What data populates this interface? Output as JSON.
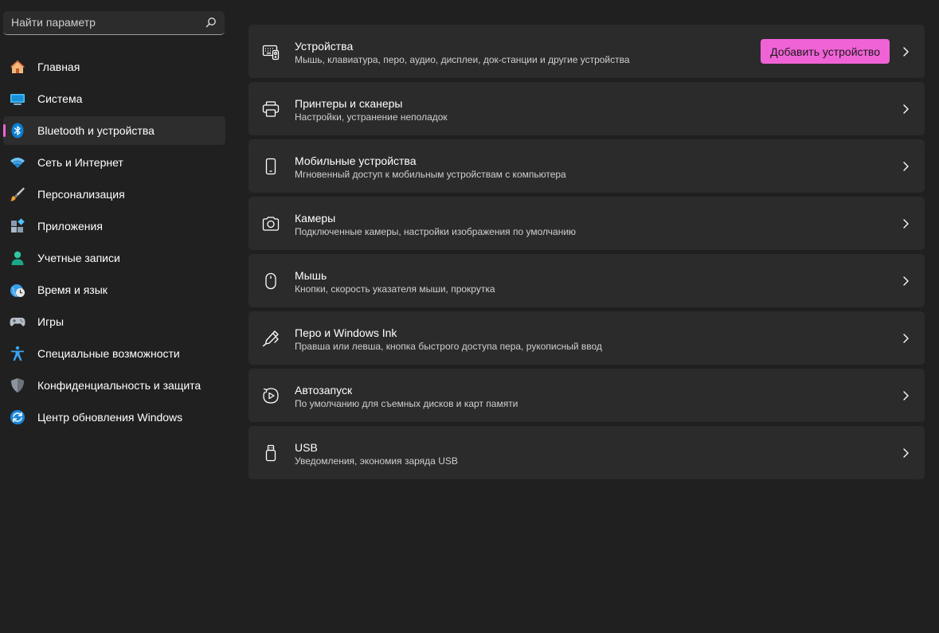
{
  "search": {
    "placeholder": "Найти параметр"
  },
  "accent_color": "#f063d6",
  "sidebar": {
    "items": [
      {
        "label": "Главная",
        "icon": "home-icon"
      },
      {
        "label": "Система",
        "icon": "monitor-icon"
      },
      {
        "label": "Bluetooth и устройства",
        "icon": "bluetooth-icon",
        "active": true
      },
      {
        "label": "Сеть и Интернет",
        "icon": "wifi-icon"
      },
      {
        "label": "Персонализация",
        "icon": "brush-icon"
      },
      {
        "label": "Приложения",
        "icon": "apps-icon"
      },
      {
        "label": "Учетные записи",
        "icon": "account-icon"
      },
      {
        "label": "Время и язык",
        "icon": "clock-globe-icon"
      },
      {
        "label": "Игры",
        "icon": "gamepad-icon"
      },
      {
        "label": "Специальные возможности",
        "icon": "accessibility-icon"
      },
      {
        "label": "Конфиденциальность и защита",
        "icon": "shield-icon"
      },
      {
        "label": "Центр обновления Windows",
        "icon": "update-icon"
      }
    ]
  },
  "main": {
    "cards": [
      {
        "title": "Устройства",
        "subtitle": "Мышь, клавиатура, перо, аудио, дисплеи, док-станции и другие устройства",
        "icon": "devices-icon",
        "button": "Добавить устройство"
      },
      {
        "title": "Принтеры и сканеры",
        "subtitle": "Настройки, устранение неполадок",
        "icon": "printer-icon"
      },
      {
        "title": "Мобильные устройства",
        "subtitle": "Мгновенный доступ к мобильным устройствам с компьютера",
        "icon": "phone-icon"
      },
      {
        "title": "Камеры",
        "subtitle": "Подключенные камеры, настройки изображения по умолчанию",
        "icon": "camera-icon"
      },
      {
        "title": "Мышь",
        "subtitle": "Кнопки, скорость указателя мыши, прокрутка",
        "icon": "mouse-icon"
      },
      {
        "title": "Перо и Windows Ink",
        "subtitle": "Правша или левша, кнопка быстрого доступа пера, рукописный ввод",
        "icon": "pen-icon"
      },
      {
        "title": "Автозапуск",
        "subtitle": "По умолчанию для съемных дисков и карт памяти",
        "icon": "autoplay-icon"
      },
      {
        "title": "USB",
        "subtitle": "Уведомления, экономия заряда USB",
        "icon": "usb-icon"
      }
    ]
  }
}
